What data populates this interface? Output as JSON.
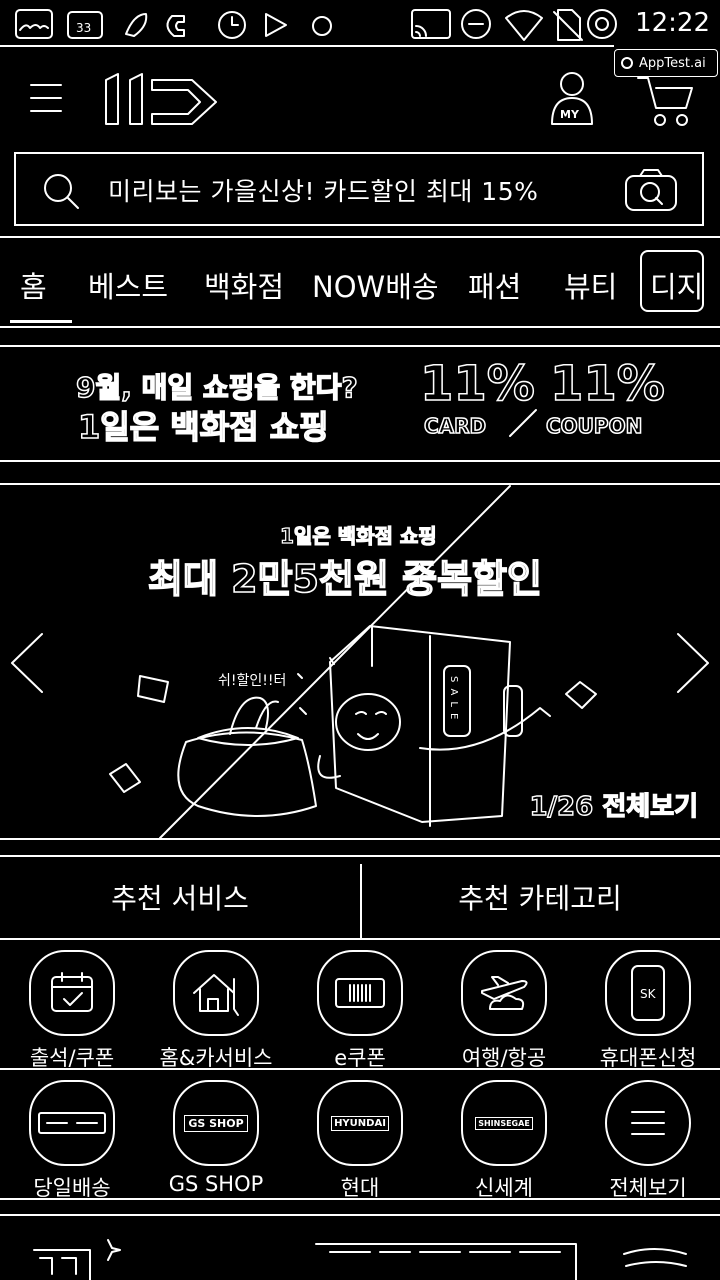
{
  "status_bar": {
    "time": "12:22",
    "left_icons": [
      "gallery-icon",
      "notification-icon",
      "flower-icon",
      "phone-icon",
      "clock-icon",
      "play-icon",
      "circle-icon"
    ],
    "right_icons": [
      "cast-icon",
      "minus-icon",
      "wifi-icon",
      "no-sim-icon",
      "sync-icon"
    ],
    "overlay_label": "AppTest.ai"
  },
  "header": {
    "logo": "11",
    "my_label": "MY",
    "icons": [
      "menu-icon",
      "user-icon",
      "cart-icon"
    ]
  },
  "search": {
    "placeholder": "미리보는 가을신상! 카드할인 최대 15%"
  },
  "tabs": [
    {
      "label": "홈"
    },
    {
      "label": "베스트"
    },
    {
      "label": "백화점"
    },
    {
      "label": "NOW배송"
    },
    {
      "label": "패션"
    },
    {
      "label": "뷰티"
    },
    {
      "label": "디지털"
    }
  ],
  "promo": {
    "line1": "9월, 매일 쇼핑을 한다?",
    "line2": "1일은 백화점 쇼핑",
    "card_value": "11%",
    "card_label": "CARD",
    "coupon_value": "11%",
    "coupon_label": "COUPON"
  },
  "banner": {
    "subtitle": "1일은 백화점 쇼핑",
    "title": "최대 2만5천원 중복할인",
    "sticker": "쉬!할인!!터",
    "sale": "SALE",
    "counter": "1/26",
    "view_all": "전체보기"
  },
  "segments": [
    {
      "label": "추천 서비스"
    },
    {
      "label": "추천 카테고리"
    }
  ],
  "services_row1": [
    {
      "label": "출석/쿠폰",
      "icon": "calendar-icon"
    },
    {
      "label": "홈&카서비스",
      "icon": "house-icon"
    },
    {
      "label": "e쿠폰",
      "icon": "ticket-icon"
    },
    {
      "label": "여행/항공",
      "icon": "airplane-icon"
    },
    {
      "label": "휴대폰신청",
      "icon": "phone-sk-icon",
      "icon_text": "SK"
    }
  ],
  "services_row2": [
    {
      "label": "당일배송",
      "icon": "delivery-logo-icon"
    },
    {
      "label": "GS SHOP",
      "icon": "gsshop-logo-icon",
      "icon_text": "GS SHOP"
    },
    {
      "label": "현대",
      "icon": "hyundai-logo-icon",
      "icon_text": "HYUNDAI"
    },
    {
      "label": "신세계",
      "icon": "shinsegae-logo-icon",
      "icon_text": "SHINSEGAE"
    },
    {
      "label": "전체보기",
      "icon": "menu-lines-icon"
    }
  ]
}
